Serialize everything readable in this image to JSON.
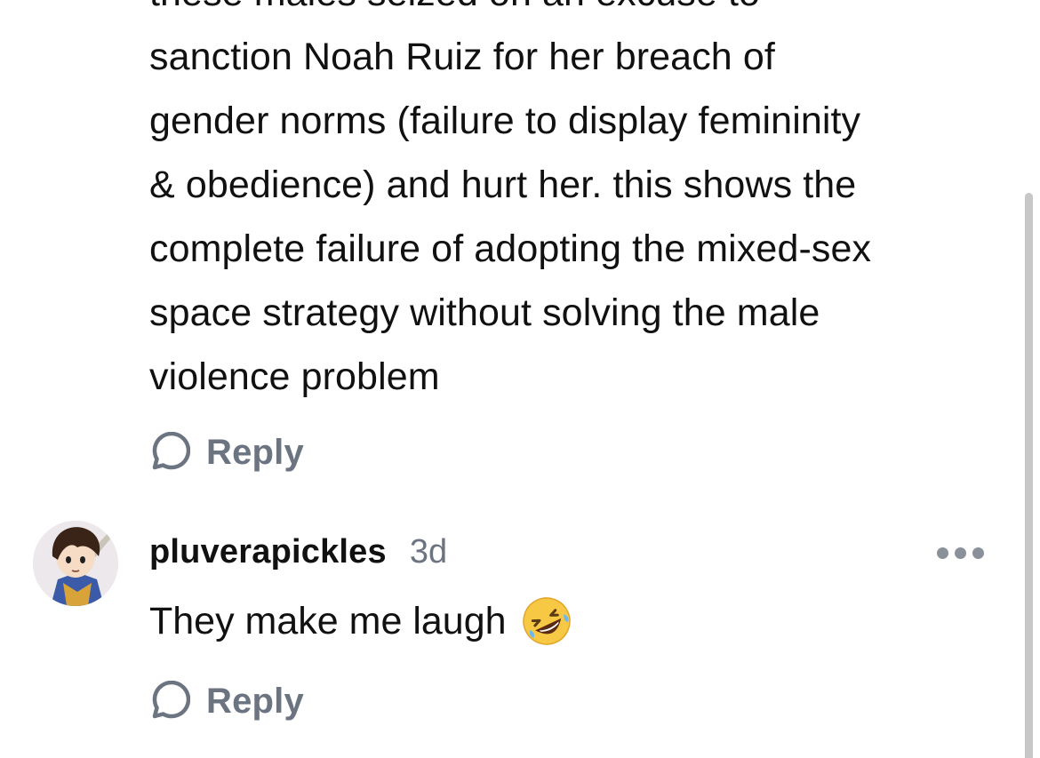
{
  "comment_1": {
    "lines": [
      "these males seized on an excuse to",
      "sanction Noah Ruiz for her breach of",
      "gender norms (failure to display femininity",
      "& obedience) and hurt her. this shows the",
      "complete failure of adopting the mixed-sex",
      "space strategy without solving the male",
      "violence problem"
    ],
    "reply_label": "Reply"
  },
  "comment_2": {
    "username": "pluverapickles",
    "timestamp": "3d",
    "text": "They make me laugh",
    "emoji": "rolling-on-floor-laughing",
    "reply_label": "Reply"
  },
  "colors": {
    "text": "#111111",
    "muted": "#6b7480",
    "scrollbar": "#c7c7c7"
  }
}
